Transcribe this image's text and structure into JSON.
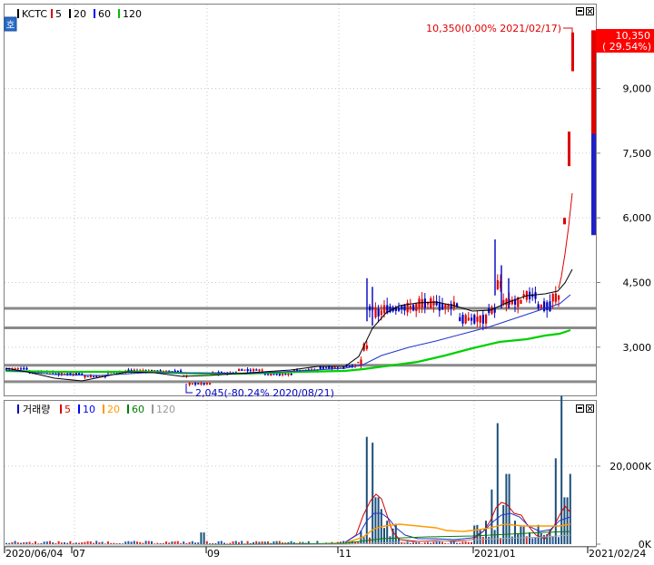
{
  "price_legend": {
    "symbol": "KCTC",
    "ma": [
      {
        "label": "5",
        "color": "#e00000"
      },
      {
        "label": "20",
        "color": "#000000"
      },
      {
        "label": "60",
        "color": "#0000ff"
      },
      {
        "label": "120",
        "color": "#00c000"
      }
    ]
  },
  "volume_legend": {
    "title": "거래량",
    "ma": [
      {
        "label": "5",
        "color": "#e00000"
      },
      {
        "label": "10",
        "color": "#0000ff"
      },
      {
        "label": "20",
        "color": "#ff9900"
      },
      {
        "label": "60",
        "color": "#008000"
      },
      {
        "label": "120",
        "color": "#999999"
      }
    ]
  },
  "toggle_label": "호",
  "chart_data": [
    {
      "type": "candlestick",
      "y_ticks": [
        "9,000",
        "7,500",
        "6,000",
        "4,500",
        "3,000"
      ],
      "y_tick_values": [
        9000,
        7500,
        6000,
        4500,
        3000
      ],
      "ylim": [
        2050,
        10800
      ],
      "last_price_box": {
        "price": "10,350",
        "change": "( 29.54%)"
      },
      "annotations": {
        "high": "10,350(0.00% 2021/02/17)",
        "high_value": 10350,
        "low": "2,045(-80.24% 2020/08/21)",
        "low_value": 2045
      },
      "support_lines": [
        3900,
        3450,
        2580,
        2200
      ],
      "colors": {
        "up": "#e00000",
        "down": "#0000c0"
      }
    },
    {
      "type": "bar",
      "y_ticks": [
        "20,000K",
        "0K"
      ],
      "y_tick_values": [
        20000,
        0
      ],
      "ylim": [
        0,
        33000
      ],
      "units": "K"
    }
  ],
  "x_axis": {
    "labels": [
      "2020/06/04",
      "07",
      "09",
      "11",
      "2021/01",
      "2021/02/24"
    ]
  }
}
